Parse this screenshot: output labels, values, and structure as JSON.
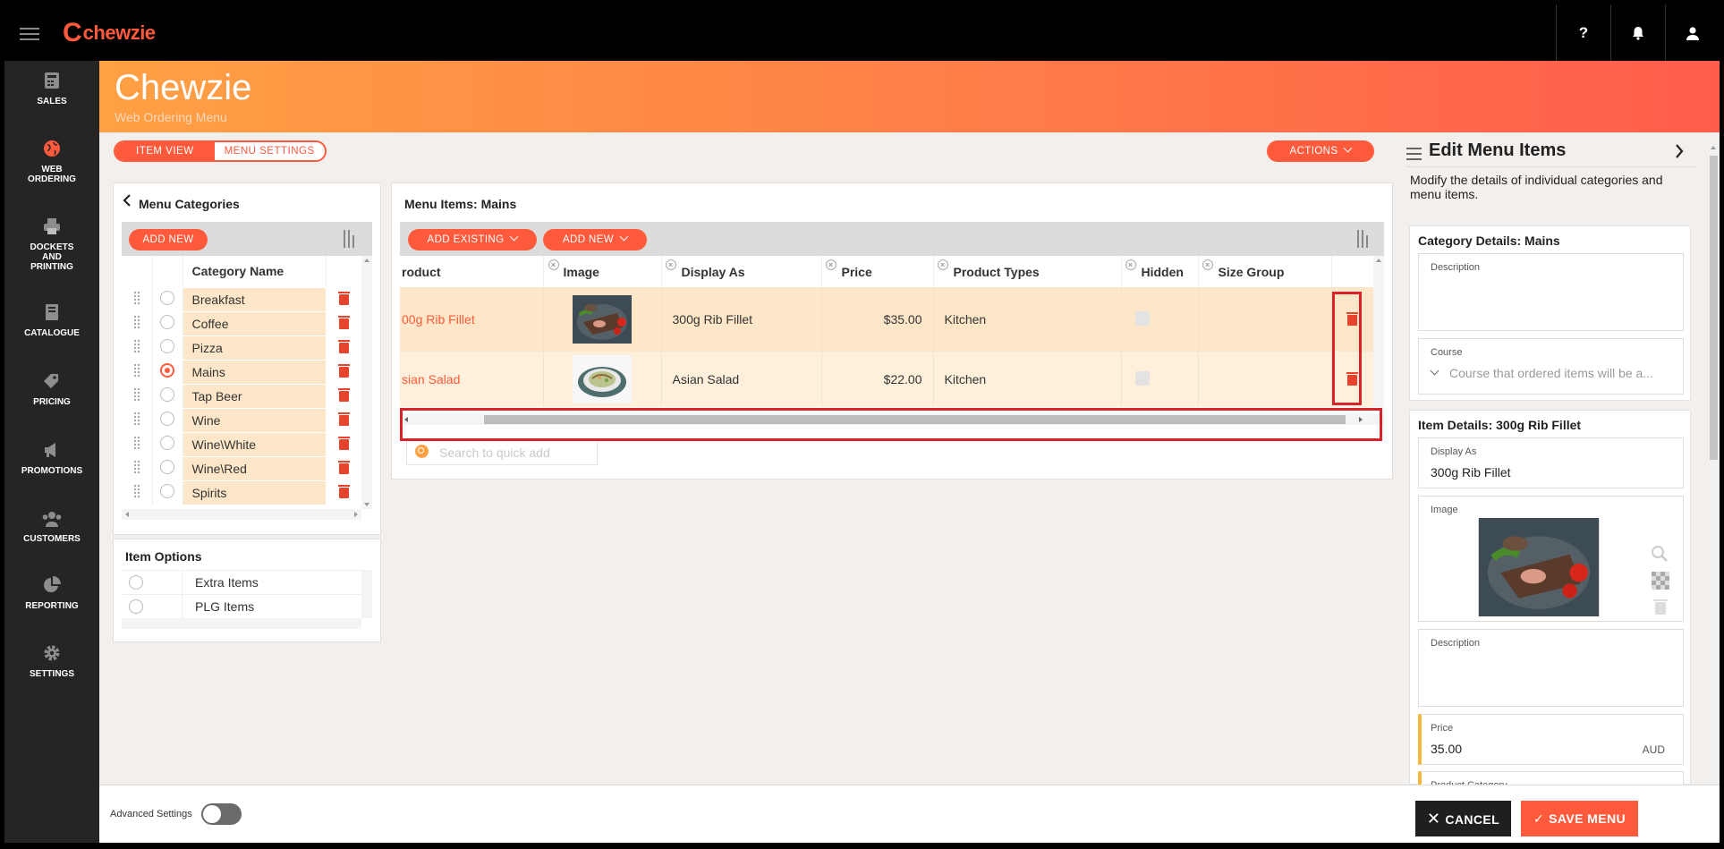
{
  "app": {
    "logo_text": "chewzie",
    "logo_letter": "C"
  },
  "topbar": {
    "help_label": "?"
  },
  "sidebar": {
    "items": [
      {
        "label": "SALES",
        "icon": "sales-icon"
      },
      {
        "label": "WEB ORDERING",
        "icon": "globe-icon"
      },
      {
        "label": "DOCKETS AND PRINTING",
        "icon": "printer-icon"
      },
      {
        "label": "CATALOGUE",
        "icon": "book-icon"
      },
      {
        "label": "PRICING",
        "icon": "tag-icon"
      },
      {
        "label": "PROMOTIONS",
        "icon": "megaphone-icon"
      },
      {
        "label": "CUSTOMERS",
        "icon": "users-icon"
      },
      {
        "label": "REPORTING",
        "icon": "pie-chart-icon"
      },
      {
        "label": "SETTINGS",
        "icon": "gear-icon"
      }
    ]
  },
  "header": {
    "title": "Chewzie",
    "subtitle": "Web Ordering Menu"
  },
  "view_toggle": {
    "item_view": "ITEM VIEW",
    "menu_settings": "MENU SETTINGS"
  },
  "actions_label": "ACTIONS",
  "categories_panel": {
    "title": "Menu Categories",
    "add_new": "ADD NEW",
    "column_header": "Category Name",
    "rows": [
      {
        "name": "Breakfast",
        "selected": false
      },
      {
        "name": "Coffee",
        "selected": false
      },
      {
        "name": "Pizza",
        "selected": false
      },
      {
        "name": "Mains",
        "selected": true
      },
      {
        "name": "Tap Beer",
        "selected": false
      },
      {
        "name": "Wine",
        "selected": false
      },
      {
        "name": "Wine\\White",
        "selected": false
      },
      {
        "name": "Wine\\Red",
        "selected": false
      },
      {
        "name": "Spirits",
        "selected": false
      }
    ]
  },
  "item_options_panel": {
    "title": "Item Options",
    "rows": [
      "Extra Items",
      "PLG Items"
    ]
  },
  "items_panel": {
    "title": "Menu Items: Mains",
    "add_existing": "ADD EXISTING",
    "add_new": "ADD NEW",
    "columns": [
      "roduct",
      "Image",
      "Display As",
      "Price",
      "Product Types",
      "Hidden",
      "Size Group"
    ],
    "rows": [
      {
        "product": "00g Rib Fillet",
        "display_as": "300g Rib Fillet",
        "price": "$35.00",
        "product_types": "Kitchen"
      },
      {
        "product": "sian Salad",
        "display_as": "Asian Salad",
        "price": "$22.00",
        "product_types": "Kitchen"
      }
    ],
    "search_placeholder": "Search to quick add"
  },
  "edit_panel": {
    "title": "Edit Menu Items",
    "description": "Modify the details of individual categories and menu items.",
    "category_details": {
      "title": "Category Details: Mains",
      "description_label": "Description",
      "course_label": "Course",
      "course_placeholder": "Course that ordered items will be a..."
    },
    "item_details": {
      "title": "Item Details: 300g Rib Fillet",
      "display_as_label": "Display As",
      "display_as_value": "300g Rib Fillet",
      "image_label": "Image",
      "description_label": "Description",
      "price_label": "Price",
      "price_value": "35.00",
      "currency": "AUD",
      "product_category_label": "Product Category"
    }
  },
  "footer": {
    "advanced_settings": "Advanced Settings",
    "cancel": "CANCEL",
    "save": "SAVE MENU"
  },
  "colors": {
    "accent": "#ff5a3c",
    "row_highlight": "#fde7c8",
    "sidebar_bg": "#252525"
  }
}
